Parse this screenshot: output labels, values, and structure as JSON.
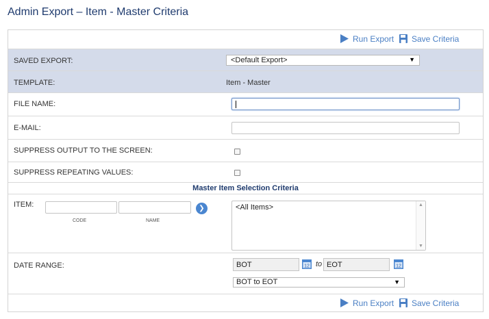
{
  "page": {
    "title": "Admin Export – Item - Master Criteria"
  },
  "toolbar": {
    "run_label": "Run Export",
    "save_label": "Save Criteria"
  },
  "saved_export": {
    "label": "SAVED EXPORT:",
    "value": "<Default Export>"
  },
  "template": {
    "label": "TEMPLATE:",
    "value": "Item - Master"
  },
  "file_name": {
    "label": "FILE NAME:",
    "value": ""
  },
  "email": {
    "label": "E-MAIL:",
    "value": ""
  },
  "suppress_output": {
    "label": "SUPPRESS OUTPUT TO THE SCREEN:",
    "checked": false
  },
  "suppress_repeating": {
    "label": "SUPPRESS REPEATING VALUES:",
    "checked": false
  },
  "section": {
    "title": "Master Item Selection Criteria"
  },
  "item": {
    "label": "ITEM:",
    "code_label": "CODE",
    "name_label": "NAME",
    "list_items": [
      "<All Items>"
    ]
  },
  "date_range": {
    "label": "DATE RANGE:",
    "from": "BOT",
    "to_word": "to",
    "to": "EOT",
    "calendar_day": "12",
    "selected": "BOT to EOT"
  },
  "colors": {
    "accent": "#4a7fc4",
    "shaded_row": "#d4dbea",
    "title": "#1f3b6e"
  },
  "icons": {
    "run": "play-icon",
    "save": "floppy-disk-icon",
    "go": "arrow-right-circle-icon",
    "calendar": "calendar-icon"
  }
}
